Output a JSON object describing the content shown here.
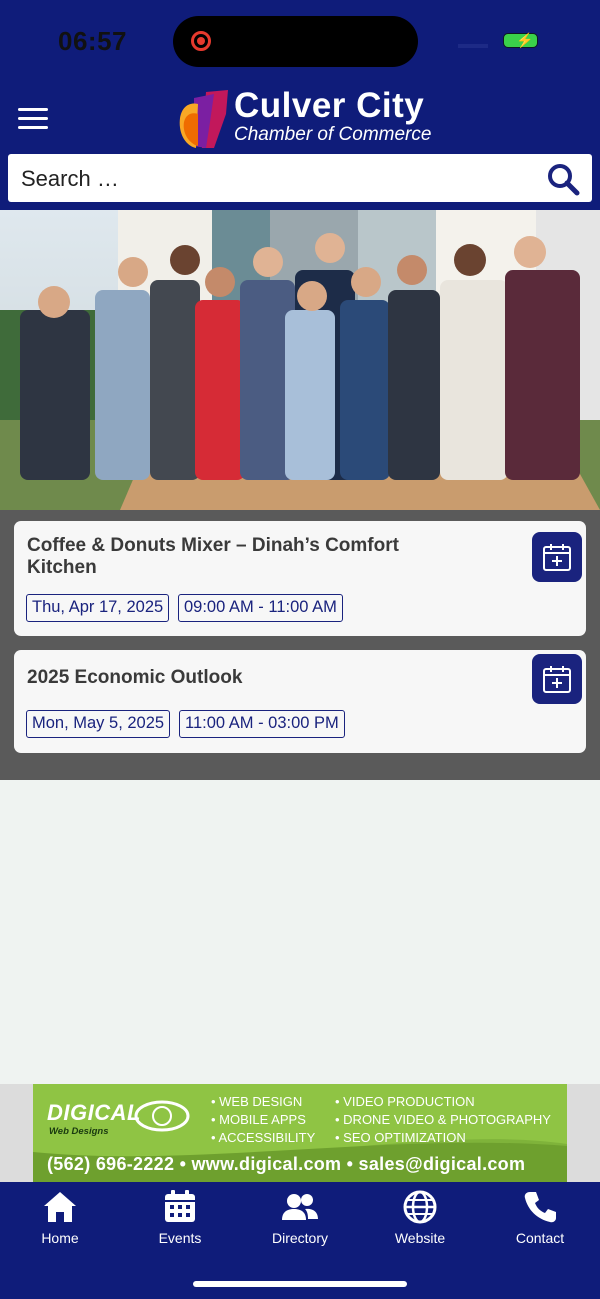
{
  "status_bar": {
    "time": "06:57"
  },
  "header": {
    "logo_title": "Culver City",
    "logo_subtitle": "Chamber of Commerce"
  },
  "search": {
    "placeholder": "Search …"
  },
  "colors": {
    "brand_navy": "#0f1c7a",
    "chip_border": "#1a237e",
    "events_bg": "#5a5a5a",
    "ad_green": "#7fb33a"
  },
  "events": [
    {
      "title": "Coffee & Donuts Mixer – Dinah’s Comfort Kitchen",
      "date": "Thu, Apr 17, 2025",
      "time": "09:00 AM - 11:00 AM",
      "action_icon": "calendar-add-icon"
    },
    {
      "title": "2025 Economic Outlook",
      "date": "Mon, May 5, 2025",
      "time": "11:00 AM - 03:00 PM",
      "action_icon": "calendar-add-icon"
    }
  ],
  "ad": {
    "brand": "DIGICAL",
    "brand_sub": "Web Designs",
    "services": [
      "• WEB DESIGN",
      "• MOBILE APPS",
      "• ACCESSIBILITY",
      "• VIDEO PRODUCTION",
      "• DRONE VIDEO & PHOTOGRAPHY",
      "• SEO OPTIMIZATION"
    ],
    "footer": "(562) 696-2222 • www.digical.com • sales@digical.com"
  },
  "tabbar": {
    "items": [
      {
        "label": "Home",
        "icon": "home-icon"
      },
      {
        "label": "Events",
        "icon": "calendar-icon"
      },
      {
        "label": "Directory",
        "icon": "people-icon"
      },
      {
        "label": "Website",
        "icon": "globe-icon"
      },
      {
        "label": "Contact",
        "icon": "phone-icon"
      }
    ]
  }
}
